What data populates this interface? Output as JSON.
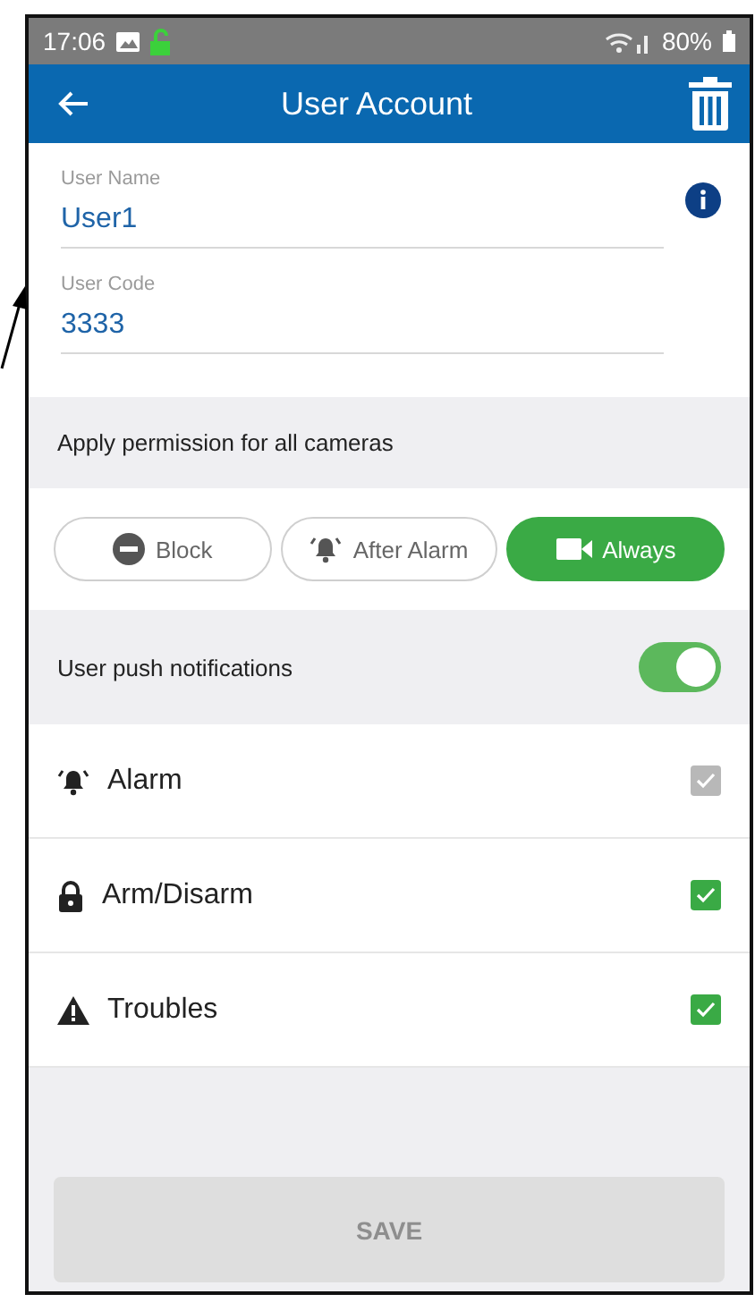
{
  "status_bar": {
    "time": "17:06",
    "battery": "80%"
  },
  "app_bar": {
    "title": "User Account"
  },
  "fields": [
    {
      "label": "User Name",
      "value": "User1",
      "info": true
    },
    {
      "label": "User Code",
      "value": "3333",
      "info": false
    }
  ],
  "permission": {
    "heading": "Apply permission for all cameras",
    "options": [
      {
        "kind": "block",
        "label": "Block",
        "selected": false
      },
      {
        "kind": "after_alarm",
        "label": "After Alarm",
        "selected": false
      },
      {
        "kind": "always",
        "label": "Always",
        "selected": true
      }
    ]
  },
  "push": {
    "label": "User push notifications",
    "on": true
  },
  "notifications": [
    {
      "kind": "alarm",
      "label": "Alarm",
      "checked": true,
      "disabled": true
    },
    {
      "kind": "arm",
      "label": "Arm/Disarm",
      "checked": true,
      "disabled": false
    },
    {
      "kind": "trouble",
      "label": "Troubles",
      "checked": true,
      "disabled": false
    }
  ],
  "save_button": {
    "label": "SAVE",
    "disabled": true
  }
}
